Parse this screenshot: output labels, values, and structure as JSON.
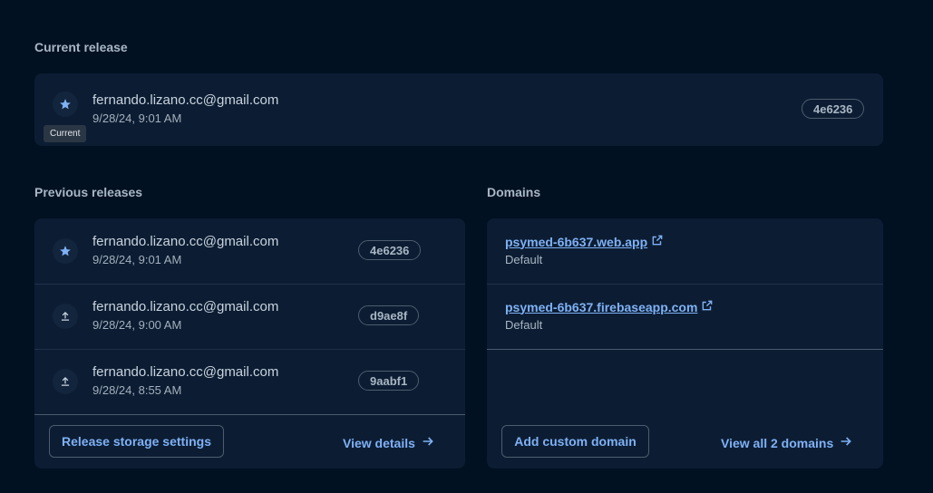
{
  "current_release": {
    "title": "Current release",
    "email": "fernando.lizano.cc@gmail.com",
    "date": "9/28/24, 9:01 AM",
    "hash": "4e6236",
    "tooltip": "Current",
    "icon": "star-icon"
  },
  "previous_releases": {
    "title": "Previous releases",
    "items": [
      {
        "email": "fernando.lizano.cc@gmail.com",
        "date": "9/28/24, 9:01 AM",
        "hash": "4e6236",
        "icon": "star-icon"
      },
      {
        "email": "fernando.lizano.cc@gmail.com",
        "date": "9/28/24, 9:00 AM",
        "hash": "d9ae8f",
        "icon": "upload-icon"
      },
      {
        "email": "fernando.lizano.cc@gmail.com",
        "date": "9/28/24, 8:55 AM",
        "hash": "9aabf1",
        "icon": "upload-icon"
      }
    ],
    "storage_button": "Release storage settings",
    "details_link": "View details"
  },
  "domains": {
    "title": "Domains",
    "items": [
      {
        "url": "psymed-6b637.web.app",
        "label": "Default",
        "icon": "external-link-icon"
      },
      {
        "url": "psymed-6b637.firebaseapp.com",
        "label": "Default",
        "icon": "external-link-icon"
      }
    ],
    "add_button": "Add custom domain",
    "view_all_link": "View all 2 domains"
  },
  "colors": {
    "background": "#021122",
    "card": "#0c1d33",
    "accent": "#7fb1f5"
  }
}
